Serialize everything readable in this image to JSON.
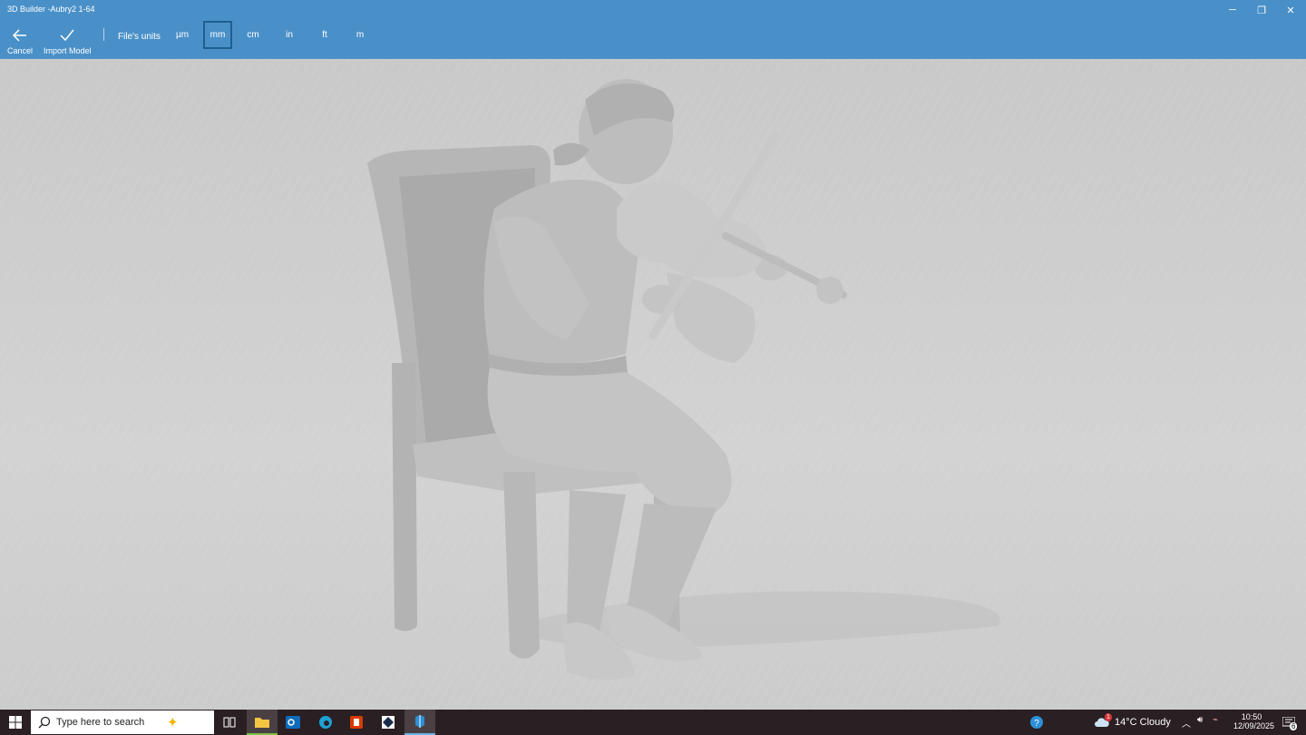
{
  "window": {
    "title": "3D Builder -Aubry2 1-64",
    "minimize": "─",
    "restore": "❐",
    "close": "✕"
  },
  "toolbar": {
    "cancel_label": "Cancel",
    "import_label": "Import Model",
    "units_label": "File's units",
    "units": [
      "µm",
      "mm",
      "cm",
      "in",
      "ft",
      "m"
    ],
    "selected_unit": "mm"
  },
  "taskbar": {
    "search_placeholder": "Type here to search",
    "weather": "14°C  Cloudy",
    "time": "10:50",
    "date": "12/09/2025",
    "notification_count": "6",
    "weather_badge": "1"
  },
  "colors": {
    "titlebar": "#4a90c8",
    "selected_border": "#1e5f8f",
    "taskbar": "#2a1f23",
    "model": "#b9b9b9"
  }
}
